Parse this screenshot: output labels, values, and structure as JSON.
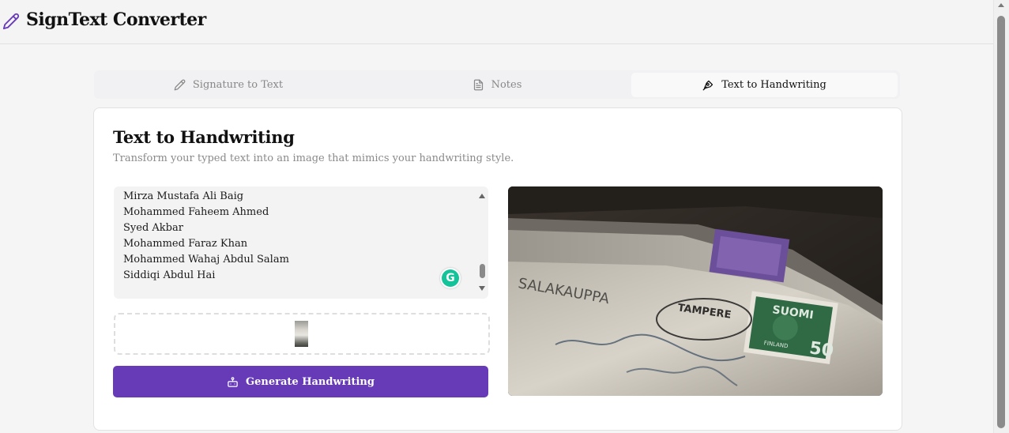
{
  "header": {
    "title": "SignText Converter"
  },
  "tabs": [
    {
      "label": "Signature to Text",
      "icon": "pencil-icon"
    },
    {
      "label": "Notes",
      "icon": "document-icon"
    },
    {
      "label": "Text to Handwriting",
      "icon": "pen-nib-icon"
    }
  ],
  "card": {
    "title": "Text to Handwriting",
    "subtitle": "Transform your typed text into an image that mimics your handwriting style."
  },
  "textarea": {
    "lines": [
      "Mirza Mustafa Ali Baig",
      "Mohammed Faheem Ahmed",
      "Syed Akbar",
      "Mohammed Faraz Khan",
      "Mohammed Wahaj Abdul Salam",
      "Siddiqi Abdul Hai"
    ]
  },
  "grammarly": {
    "letter": "G"
  },
  "generate_button": {
    "label": "Generate Handwriting"
  },
  "preview": {
    "stamp_country": "SUOMI",
    "stamp_sub": "FINLAND",
    "stamp_value": "50",
    "postmark_city": "TAMPERE",
    "envelope_text": "SALAKAUPPA"
  },
  "colors": {
    "accent": "#673ab7",
    "grammarly": "#15c39a"
  }
}
